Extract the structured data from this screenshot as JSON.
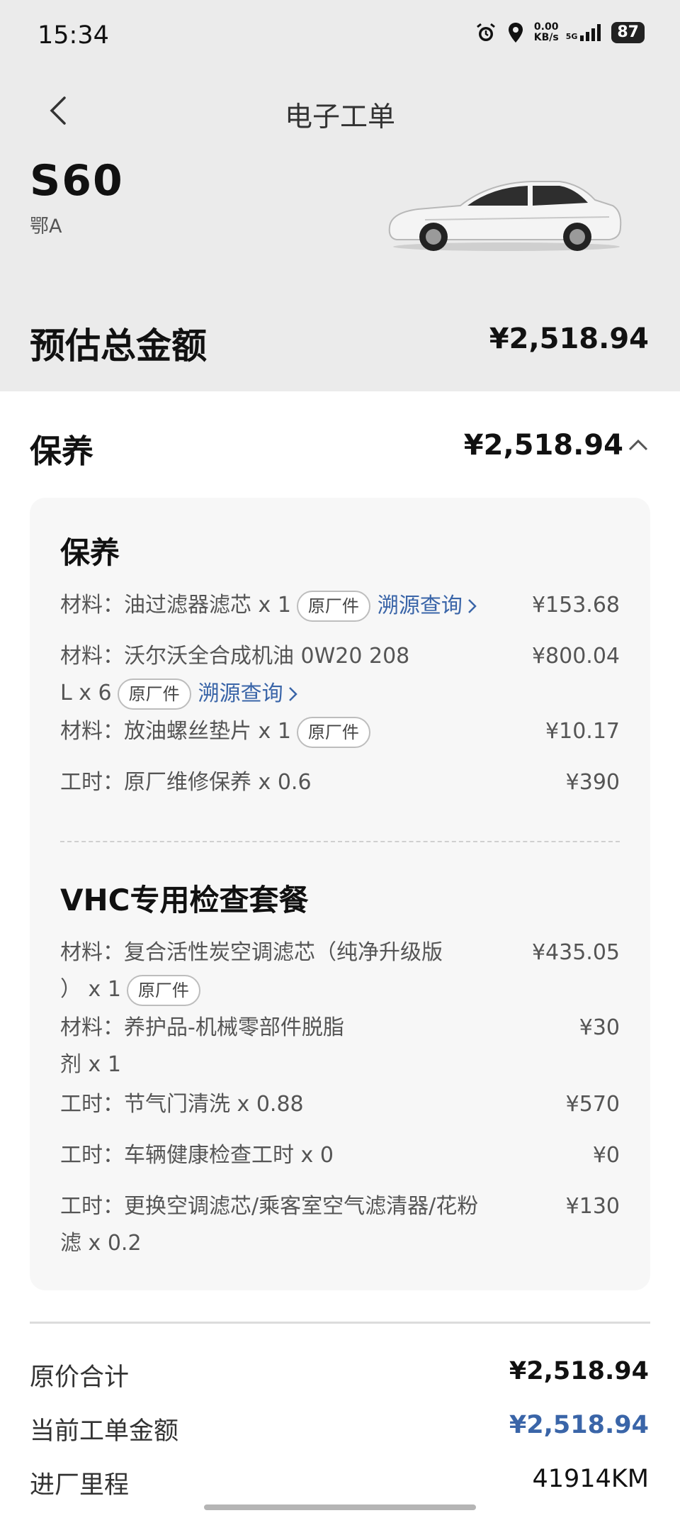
{
  "status_bar": {
    "time": "15:34",
    "net_speed": "0.00",
    "net_unit": "KB/s",
    "signal": "5G",
    "battery": "87"
  },
  "nav": {
    "title": "电子工单"
  },
  "vehicle": {
    "model": "S60",
    "plate": "鄂A"
  },
  "estimate": {
    "label": "预估总金额",
    "value": "¥2,518.94"
  },
  "section": {
    "label": "保养",
    "value": "¥2,518.94"
  },
  "groups": [
    {
      "title": "保养",
      "items": [
        {
          "text": "材料：油过滤器滤芯 x 1",
          "tag": "原厂件",
          "link": "溯源查询",
          "price": "¥153.68"
        },
        {
          "text_line1": "材料：沃尔沃全合成机油 0W20 208",
          "text_line2": "L x 6",
          "tag": "原厂件",
          "link": "溯源查询",
          "price": "¥800.04"
        },
        {
          "text": "材料：放油螺丝垫片 x 1",
          "tag": "原厂件",
          "price": "¥10.17"
        },
        {
          "text": "工时：原厂维修保养 x 0.6",
          "price": "¥390"
        }
      ]
    },
    {
      "title": "VHC专用检查套餐",
      "items": [
        {
          "text_line1": "材料：复合活性炭空调滤芯（纯净升级版",
          "text_line2": "） x 1",
          "tag": "原厂件",
          "price": "¥435.05"
        },
        {
          "text_line1": "材料：养护品-机械零部件脱脂",
          "text_line2": "剂 x 1",
          "price": "¥30"
        },
        {
          "text": "工时：节气门清洗 x 0.88",
          "price": "¥570"
        },
        {
          "text": "工时：车辆健康检查工时 x 0",
          "price": "¥0"
        },
        {
          "text_line1": "工时：更换空调滤芯/乘客室空气滤清器/花粉",
          "text_line2": "滤 x 0.2",
          "price": "¥130"
        }
      ]
    }
  ],
  "summary": {
    "original_label": "原价合计",
    "original_value": "¥2,518.94",
    "current_label": "当前工单金额",
    "current_value": "¥2,518.94",
    "mileage_label": "进厂里程",
    "mileage_value": "41914KM"
  },
  "colors": {
    "accent": "#3a65a8",
    "header_bg": "#ebebeb",
    "card_bg": "#f7f7f7"
  }
}
